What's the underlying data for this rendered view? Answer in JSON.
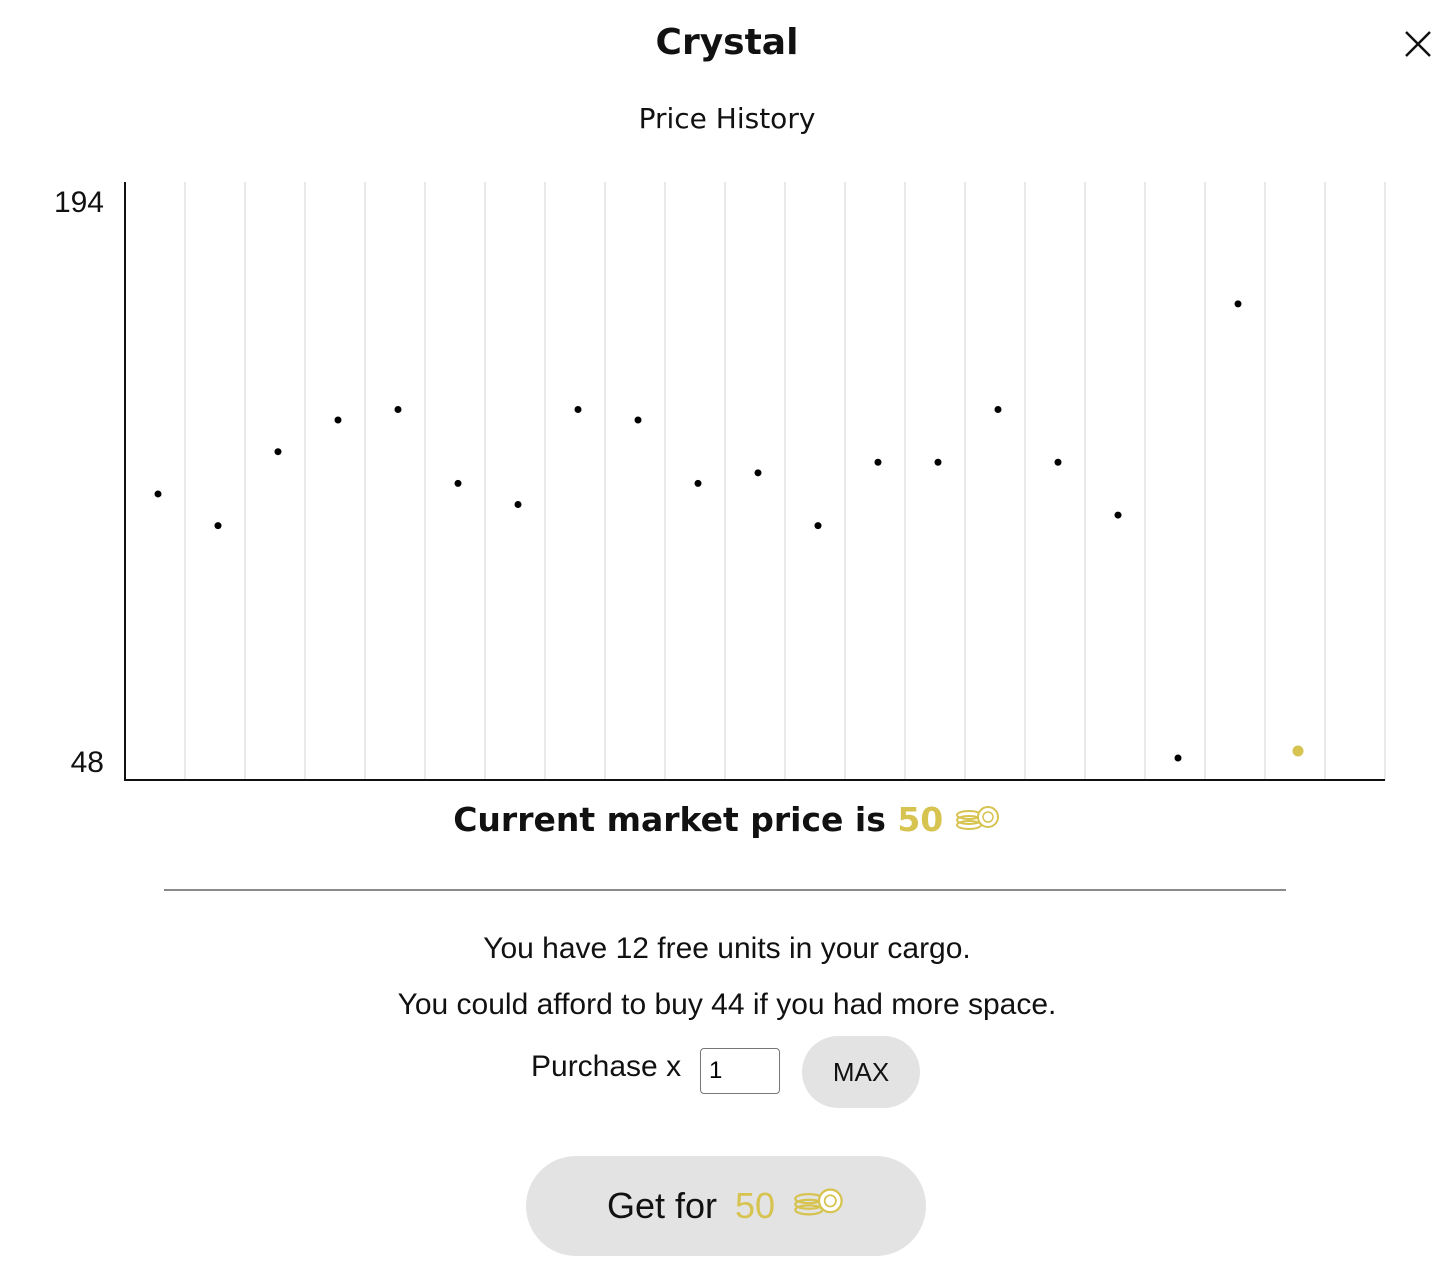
{
  "dialog": {
    "title": "Crystal",
    "subtitle": "Price History",
    "close_icon": "close-icon"
  },
  "chart_data": {
    "type": "scatter",
    "ylim": [
      48,
      194
    ],
    "ytick_labels": [
      "194",
      "48"
    ],
    "grid": "vertical",
    "point_color": "#000000",
    "highlight_color": "#d6c350",
    "values": [
      123,
      114,
      135,
      144,
      147,
      126,
      120,
      147,
      144,
      126,
      129,
      114,
      132,
      132,
      147,
      132,
      117,
      48,
      177,
      50
    ],
    "highlight_index": 19
  },
  "market": {
    "prefix": "Current market price is ",
    "price": "50",
    "coin_icon": "coins-icon",
    "accent": "#d6c350"
  },
  "info": {
    "cargo_text": "You have 12 free units in your cargo.",
    "afford_text": "You could afford to buy 44 if you had more space."
  },
  "purchase": {
    "label": "Purchase x",
    "quantity": "1",
    "max_label": "MAX"
  },
  "buy": {
    "label": "Get for",
    "price": "50"
  }
}
